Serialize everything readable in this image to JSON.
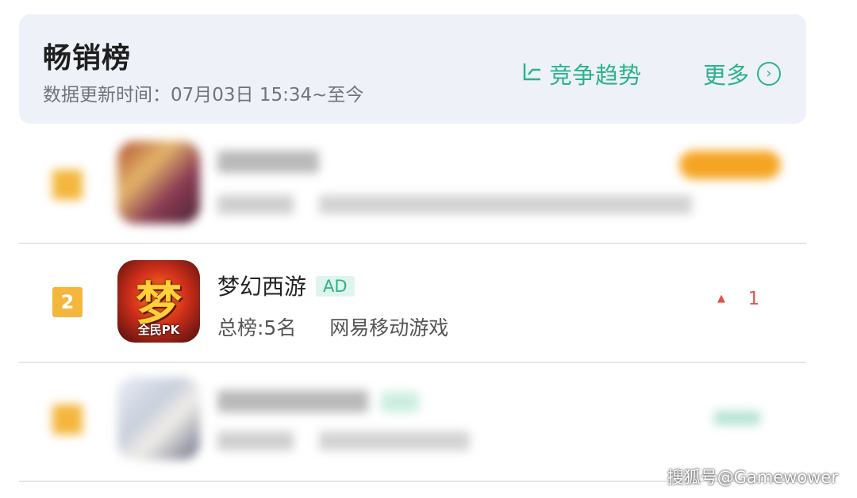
{
  "header": {
    "title": "畅销榜",
    "update_time": "数据更新时间：07月03日 15:34~至今",
    "trend_label": "竞争趋势",
    "trend_icon": "line-chart-icon",
    "more_label": "更多",
    "more_icon": "chevron-right-circle-icon",
    "accent_color": "#2bb38a"
  },
  "rows": [
    {
      "rank": "",
      "name": "",
      "sub": "",
      "badge": "",
      "blurred": true
    },
    {
      "rank": "2",
      "name": "梦幻西游",
      "badge": "AD",
      "overall_rank": "总榜:5名",
      "publisher": "网易移动游戏",
      "change_arrow": "▲",
      "change_value": "1",
      "icon_text": "梦",
      "icon_caption": "全民PK",
      "blurred": false
    },
    {
      "rank": "",
      "name": "",
      "sub": "",
      "blurred": true
    }
  ],
  "watermark": "搜狐号@Gamewower",
  "colors": {
    "rank_badge": "#f4b63d",
    "rise": "#e0524c",
    "highlight_badge": "#f5a524"
  }
}
